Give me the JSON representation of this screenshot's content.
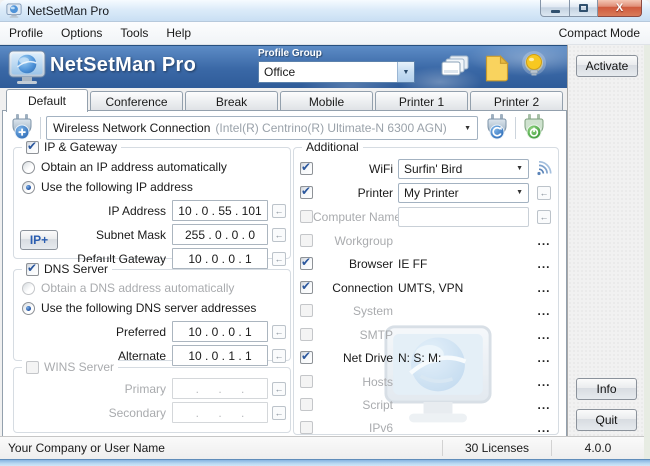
{
  "window": {
    "title": "NetSetMan Pro"
  },
  "menubar": {
    "items": [
      "Profile",
      "Options",
      "Tools",
      "Help"
    ],
    "right_label": "Compact Mode"
  },
  "header": {
    "app_name": "NetSetMan Pro",
    "profile_group_label": "Profile Group",
    "profile_group_value": "Office",
    "activate_button": "Activate"
  },
  "tabs": {
    "items": [
      {
        "label": "Default",
        "active": true
      },
      {
        "label": "Conference",
        "active": false
      },
      {
        "label": "Break",
        "active": false
      },
      {
        "label": "Mobile",
        "active": false
      },
      {
        "label": "Printer 1",
        "active": false
      },
      {
        "label": "Printer 2",
        "active": false
      }
    ]
  },
  "adapter": {
    "name": "Wireless Network Connection",
    "detail": "(Intel(R) Centrino(R) Ultimate-N 6300 AGN)"
  },
  "ip_gateway": {
    "title": "IP & Gateway",
    "enabled": true,
    "obtain_auto": "Obtain an IP address automatically",
    "obtain_selected": false,
    "use_following": "Use the following IP address",
    "use_selected": true,
    "ip_plus_button": "IP+",
    "fields": [
      {
        "label": "IP Address",
        "value": "10 . 0 . 55 . 101"
      },
      {
        "label": "Subnet Mask",
        "value": "255 . 0 . 0 . 0"
      },
      {
        "label": "Default Gateway",
        "value": "10 . 0 . 0 . 1"
      }
    ]
  },
  "dns_server": {
    "title": "DNS Server",
    "enabled": true,
    "obtain_auto": "Obtain a DNS address automatically",
    "obtain_selected": false,
    "use_following": "Use the following DNS server addresses",
    "use_selected": true,
    "fields": [
      {
        "label": "Preferred",
        "value": "10 . 0 . 0 . 1"
      },
      {
        "label": "Alternate",
        "value": "10 . 0 . 1 . 1"
      }
    ]
  },
  "wins_server": {
    "title": "WINS Server",
    "enabled": false,
    "fields": [
      {
        "label": "Primary",
        "value": ". . ."
      },
      {
        "label": "Secondary",
        "value": ". . ."
      }
    ]
  },
  "additional": {
    "title": "Additional",
    "dots_label": "...",
    "rows": [
      {
        "label": "WiFi",
        "value": "Surfin' Bird",
        "checked": true
      },
      {
        "label": "Printer",
        "value": "My Printer",
        "checked": true
      },
      {
        "label": "Computer Name",
        "value": "",
        "checked": false
      },
      {
        "label": "Workgroup",
        "value": "",
        "checked": false
      },
      {
        "label": "Browser",
        "value": "IE FF",
        "checked": true
      },
      {
        "label": "Connection",
        "value": "UMTS, VPN",
        "checked": true
      },
      {
        "label": "System",
        "value": "",
        "checked": false
      },
      {
        "label": "SMTP",
        "value": "",
        "checked": false
      },
      {
        "label": "Net Drive",
        "value": "N: S: M:",
        "checked": true
      },
      {
        "label": "Hosts",
        "value": "",
        "checked": false
      },
      {
        "label": "Script",
        "value": "",
        "checked": false
      },
      {
        "label": "IPv6",
        "value": "",
        "checked": false
      }
    ]
  },
  "sidebar": {
    "info_button": "Info",
    "quit_button": "Quit"
  },
  "statusbar": {
    "company": "Your Company or User Name",
    "licenses": "30 Licenses",
    "version": "4.0.0"
  }
}
